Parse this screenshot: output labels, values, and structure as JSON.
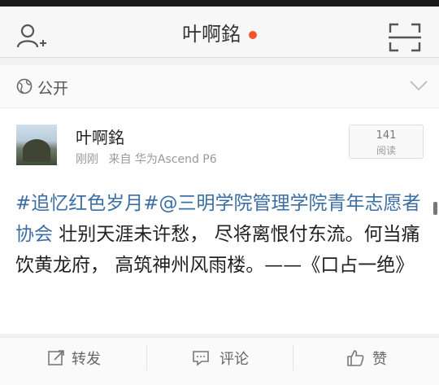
{
  "header": {
    "title": "叶啊銘",
    "dot_color": "#f4552a"
  },
  "privacy": {
    "label": "公开"
  },
  "post": {
    "username": "叶啊銘",
    "time": "刚刚",
    "source": "来自 华为Ascend P6",
    "read_count": "141",
    "read_label": "阅读",
    "tag1": "#追忆红色岁月#",
    "tag2": "@三明学院管理学院青年志愿者协会",
    "text": " 壮别天涯未许愁， 尽将离恨付东流。何当痛饮黄龙府， 高筑神州风雨楼。——《口占一绝》",
    "link_color": "#3a6ea5"
  },
  "actions": {
    "repost": "转发",
    "comment": "评论",
    "like": "赞"
  }
}
